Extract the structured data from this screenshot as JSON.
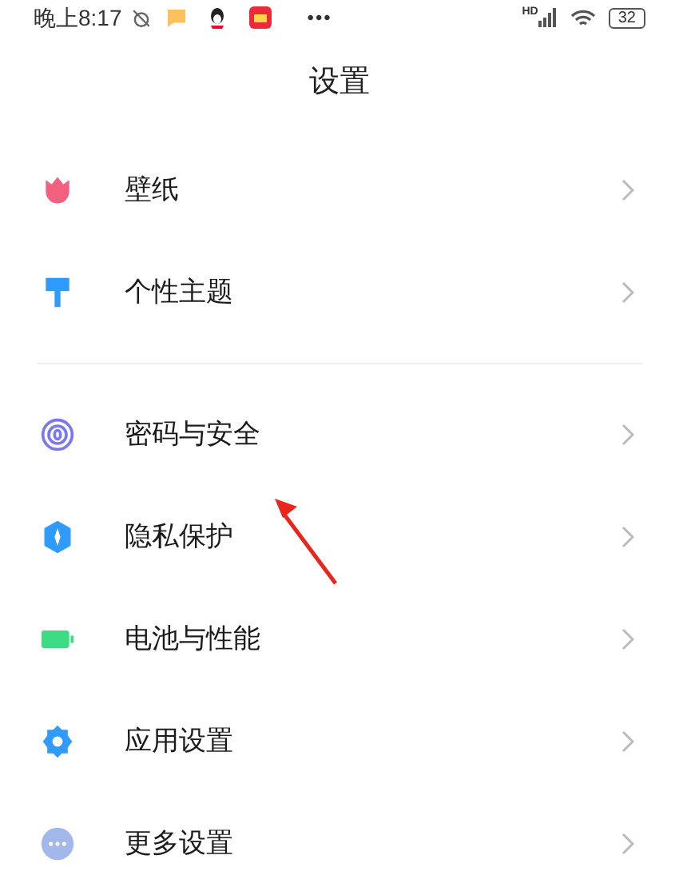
{
  "status_bar": {
    "time": "晚上8:17",
    "more": "•••",
    "network": "HD",
    "battery": "32"
  },
  "title": "设置",
  "groups": [
    {
      "items": [
        {
          "label": "壁纸"
        },
        {
          "label": "个性主题"
        }
      ]
    },
    {
      "items": [
        {
          "label": "密码与安全"
        },
        {
          "label": "隐私保护"
        },
        {
          "label": "电池与性能"
        },
        {
          "label": "应用设置"
        },
        {
          "label": "更多设置"
        }
      ]
    }
  ]
}
